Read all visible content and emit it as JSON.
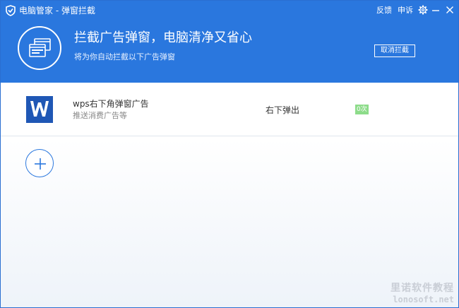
{
  "window": {
    "title": "电脑管家 - 弹窗拦截",
    "feedback": "反馈",
    "appeal": "申诉"
  },
  "colors": {
    "header_blue": "#2a77de",
    "wps_blue": "#1f57b5",
    "count_badge_green": "#8ddc8a"
  },
  "hero": {
    "icon": "window-stack-icon",
    "title": "拦截广告弹窗，电脑清净又省心",
    "subtitle": "将为你自动拦截以下广告弹窗",
    "cancel_label": "取消拦截"
  },
  "rules": [
    {
      "icon": "wps-icon",
      "name": "wps右下角弹窗广告",
      "description": "推送消费广告等",
      "position": "右下弹出",
      "count": "0次"
    }
  ],
  "watermark": {
    "line1": "里诺软件教程",
    "line2": "lonosoft.net"
  }
}
